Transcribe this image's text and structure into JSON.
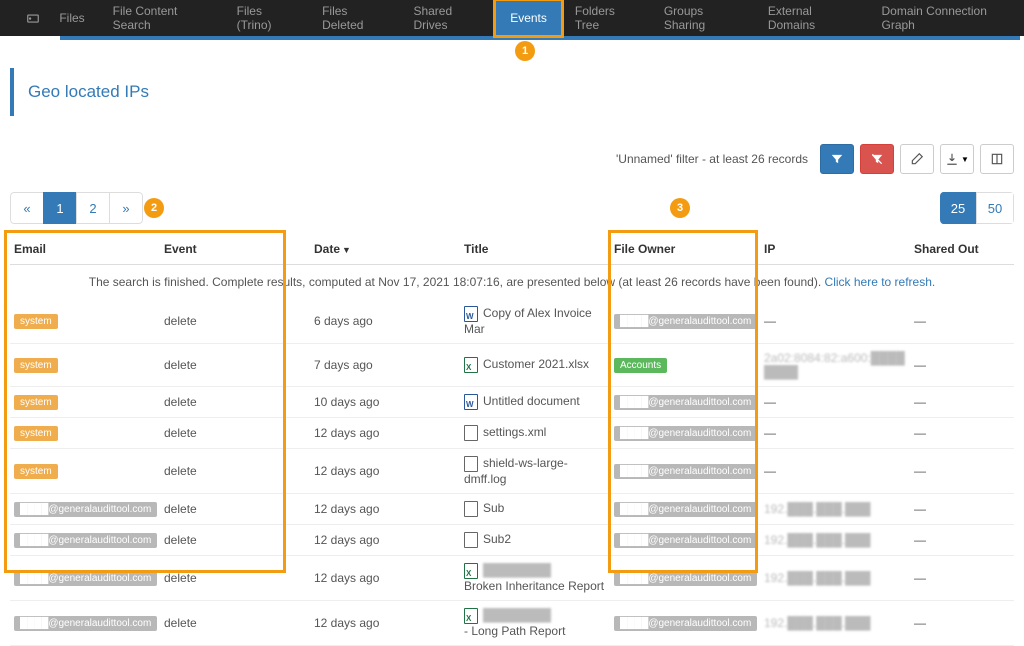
{
  "nav": {
    "tabs": [
      "Files",
      "File Content Search",
      "Files (Trino)",
      "Files Deleted",
      "Shared Drives",
      "Events",
      "Folders Tree",
      "Groups Sharing",
      "External Domains",
      "Domain Connection Graph"
    ],
    "active_index": 5
  },
  "markers": {
    "m1": "1",
    "m2": "2",
    "m3": "3"
  },
  "page_title": "Geo located IPs",
  "filterbar": {
    "text": "'Unnamed' filter -   at least 26 records"
  },
  "pager": {
    "prev": "«",
    "p1": "1",
    "p2": "2",
    "next": "»"
  },
  "pagesize": {
    "s25": "25",
    "s50": "50"
  },
  "table": {
    "headers": {
      "email": "Email",
      "event": "Event",
      "date": "Date",
      "title": "Title",
      "owner": "File Owner",
      "ip": "IP",
      "shared": "Shared Out"
    },
    "status_a": "The search is finished. Complete results, computed at Nov 17, 2021 18:07:16, are presented below (at least 26 records have been found). ",
    "status_link": "Click here to refresh.",
    "rows": [
      {
        "email_badge": "system",
        "email_style": "orange",
        "event": "delete",
        "date": "6 days ago",
        "icon": "word",
        "title": "Copy of Alex Invoice Mar",
        "owner": "████@generalaudittool.com",
        "owner_style": "grey",
        "ip": "—",
        "shared": "—"
      },
      {
        "email_badge": "system",
        "email_style": "orange",
        "event": "delete",
        "date": "7 days ago",
        "icon": "xls",
        "title": "Customer 2021.xlsx",
        "owner": "Accounts",
        "owner_style": "green",
        "ip": "2a02:8084:82:a600:████ ████",
        "shared": "—"
      },
      {
        "email_badge": "system",
        "email_style": "orange",
        "event": "delete",
        "date": "10 days ago",
        "icon": "word",
        "title": "Untitled document",
        "owner": "████@generalaudittool.com",
        "owner_style": "grey",
        "ip": "—",
        "shared": "—"
      },
      {
        "email_badge": "system",
        "email_style": "orange",
        "event": "delete",
        "date": "12 days ago",
        "icon": "doc",
        "title": "settings.xml",
        "owner": "████@generalaudittool.com",
        "owner_style": "grey",
        "ip": "—",
        "shared": "—"
      },
      {
        "email_badge": "system",
        "email_style": "orange",
        "event": "delete",
        "date": "12 days ago",
        "icon": "doc",
        "title": "shield-ws-large-dmff.log",
        "owner": "████@generalaudittool.com",
        "owner_style": "grey",
        "ip": "—",
        "shared": "—"
      },
      {
        "email_badge": "████@generalaudittool.com",
        "email_style": "grey",
        "event": "delete",
        "date": "12 days ago",
        "icon": "doc",
        "title": "Sub",
        "owner": "████@generalaudittool.com",
        "owner_style": "grey",
        "ip": "192.███.███.███",
        "shared": "—"
      },
      {
        "email_badge": "████@generalaudittool.com",
        "email_style": "grey",
        "event": "delete",
        "date": "12 days ago",
        "icon": "doc",
        "title": "Sub2",
        "owner": "████@generalaudittool.com",
        "owner_style": "grey",
        "ip": "192.███.███.███",
        "shared": "—"
      },
      {
        "email_badge": "████@generalaudittool.com",
        "email_style": "grey",
        "event": "delete",
        "date": "12 days ago",
        "icon": "xls",
        "title": "████████\nBroken Inheritance Report",
        "owner": "████@generalaudittool.com",
        "owner_style": "grey",
        "ip": "192.███.███.███",
        "shared": "—"
      },
      {
        "email_badge": "████@generalaudittool.com",
        "email_style": "grey",
        "event": "delete",
        "date": "12 days ago",
        "icon": "xls",
        "title": "████████\n- Long Path Report",
        "owner": "████@generalaudittool.com",
        "owner_style": "grey",
        "ip": "192.███.███.███",
        "shared": "—"
      }
    ]
  }
}
